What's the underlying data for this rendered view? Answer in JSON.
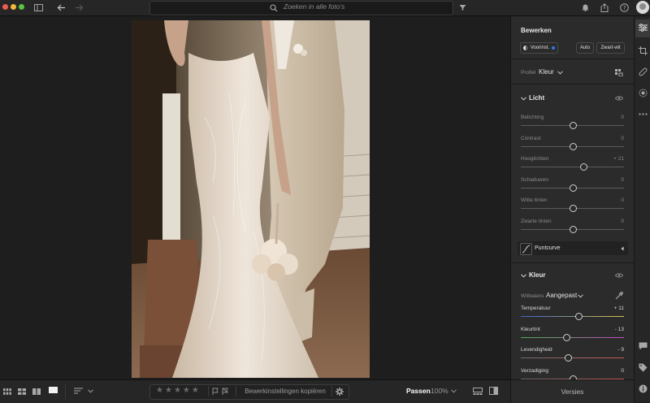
{
  "search": {
    "placeholder": "Zoeken in alle foto's"
  },
  "panel": {
    "title": "Bewerken",
    "presets_label": "Voorinst.",
    "auto_label": "Auto",
    "bw_label": "Zwart-wit",
    "profile_label": "Profiel",
    "profile_value": "Kleur",
    "light": {
      "title": "Licht",
      "sliders": [
        {
          "label": "Belichting",
          "value": "0",
          "level": 0.5
        },
        {
          "label": "Contrast",
          "value": "0",
          "level": 0.5
        },
        {
          "label": "Hooglichten",
          "value": "+ 21",
          "level": 0.61
        },
        {
          "label": "Schaduwen",
          "value": "0",
          "level": 0.5
        },
        {
          "label": "Witte tinten",
          "value": "0",
          "level": 0.5
        },
        {
          "label": "Zwarte tinten",
          "value": "0",
          "level": 0.5
        }
      ],
      "curve_label": "Puntcurve"
    },
    "color": {
      "title": "Kleur",
      "wb_label": "Witbalans",
      "wb_value": "Aangepast",
      "sliders": [
        {
          "label": "Temperatuur",
          "value": "+ 11",
          "level": 0.56
        },
        {
          "label": "Kleurtint",
          "value": "- 13",
          "level": 0.44
        },
        {
          "label": "Levendigheid",
          "value": "- 9",
          "level": 0.46
        },
        {
          "label": "Verzadiging",
          "value": "0",
          "level": 0.5
        }
      ]
    },
    "versions_label": "Versies"
  },
  "bottombar": {
    "copy_label": "Bewerkinstellingen kopiëren",
    "fit_label": "Passen",
    "zoom_value": "100%",
    "rating_stars": 5
  },
  "colors": {
    "accent": "#2d7be5",
    "temp_gradient": [
      "#3a63c9",
      "#d8c24a"
    ],
    "tint_gradient": [
      "#4cae4c",
      "#c44cc4"
    ]
  }
}
